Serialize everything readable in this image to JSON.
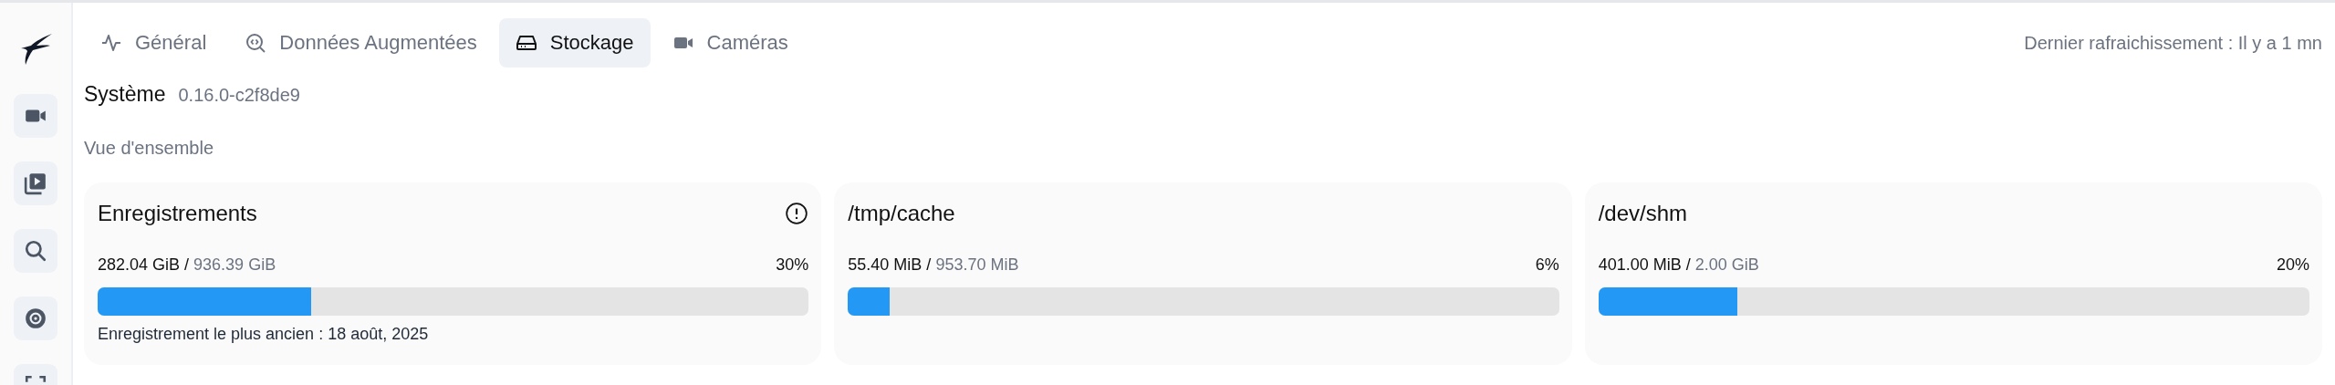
{
  "sidebar": {
    "items": [
      {
        "kind": "video"
      },
      {
        "kind": "play"
      },
      {
        "kind": "search"
      },
      {
        "kind": "disc"
      },
      {
        "kind": "scan"
      }
    ]
  },
  "tabs": [
    {
      "label": "Général",
      "kind": "pulse",
      "selected": false
    },
    {
      "label": "Données Augmentées",
      "kind": "search-code",
      "selected": false
    },
    {
      "label": "Stockage",
      "kind": "drive",
      "selected": true
    },
    {
      "label": "Caméras",
      "kind": "video",
      "selected": false
    }
  ],
  "last_refresh": "Dernier rafraichissement : Il y a 1 mn",
  "system": {
    "title": "Système",
    "version": "0.16.0-c2f8de9"
  },
  "section_title": "Vue d'ensemble",
  "cards": [
    {
      "title": "Enregistrements",
      "info_icon": true,
      "used": "282.04 GiB",
      "separator": "/",
      "total": "936.39 GiB",
      "percent": "30%",
      "level": 0.3,
      "note": "Enregistrement le plus ancien : 18 août, 2025"
    },
    {
      "title": "/tmp/cache",
      "info_icon": false,
      "used": "55.40 MiB",
      "separator": "/",
      "total": "953.70 MiB",
      "percent": "6%",
      "level": 0.058
    },
    {
      "title": "/dev/shm",
      "info_icon": false,
      "used": "401.00 MiB",
      "separator": "/",
      "total": "2.00 GiB",
      "percent": "20%",
      "level": 0.196
    }
  ]
}
